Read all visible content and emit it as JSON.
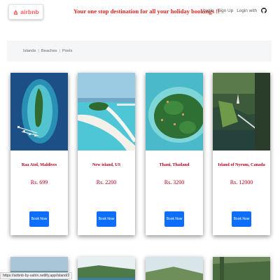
{
  "header": {
    "logo_text": "airbnb",
    "tagline": "Your one stop destination for all your holiday bookings !!",
    "nav": [
      "Login",
      "Sign Up",
      "Login with"
    ]
  },
  "filters": [
    "Islands",
    "Beaches",
    "Pools"
  ],
  "cards": [
    {
      "place": "Raa Atol, Maldives",
      "price": "Rs. 699",
      "button": "Book Now"
    },
    {
      "place": "New island, US",
      "price": "Rs. 2200",
      "button": "Book Now"
    },
    {
      "place": "Thani, Thailand",
      "price": "Rs. 3200",
      "button": "Book Now"
    },
    {
      "place": "Island of Nyrum, Canada",
      "price": "Rs. 12000",
      "button": "Book Now"
    }
  ],
  "status_url": "https://airbnb-by-sahin.netlify.app/island/2",
  "colors": {
    "brand": "#ff5a5f",
    "tagline": "#e0201c",
    "price": "#b3001b",
    "button": "#0d6efd"
  }
}
